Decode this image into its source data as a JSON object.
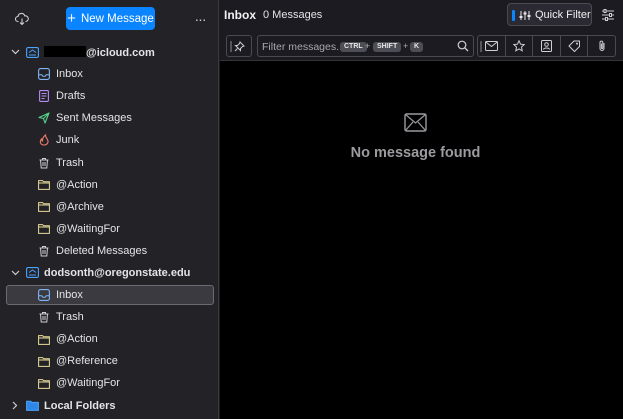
{
  "toolbar": {
    "get_messages_icon": "cloud-download-icon",
    "new_message_label": "New Message",
    "more_label": "···"
  },
  "accounts": [
    {
      "email_suffix": "@icloud.com",
      "redacted": true,
      "expanded": true,
      "folders": [
        {
          "label": "Inbox",
          "icon": "inbox-icon",
          "color": "#7fb5f5"
        },
        {
          "label": "Drafts",
          "icon": "drafts-icon",
          "color": "#b58cf0"
        },
        {
          "label": "Sent Messages",
          "icon": "sent-icon",
          "color": "#59d28a"
        },
        {
          "label": "Junk",
          "icon": "junk-icon",
          "color": "#f07a6a"
        },
        {
          "label": "Trash",
          "icon": "trash-icon",
          "color": "#cfcfd2"
        },
        {
          "label": "@Action",
          "icon": "folder-icon",
          "color": "#e9dd9a"
        },
        {
          "label": "@Archive",
          "icon": "folder-icon",
          "color": "#e9dd9a"
        },
        {
          "label": "@WaitingFor",
          "icon": "folder-icon",
          "color": "#e9dd9a"
        },
        {
          "label": "Deleted Messages",
          "icon": "trash-icon",
          "color": "#cfcfd2"
        }
      ]
    },
    {
      "email": "dodsonth@oregonstate.edu",
      "expanded": true,
      "folders": [
        {
          "label": "Inbox",
          "icon": "inbox-icon",
          "color": "#7fb5f5",
          "selected": true
        },
        {
          "label": "Trash",
          "icon": "trash-icon",
          "color": "#cfcfd2"
        },
        {
          "label": "@Action",
          "icon": "folder-icon",
          "color": "#e9dd9a"
        },
        {
          "label": "@Reference",
          "icon": "folder-icon",
          "color": "#e9dd9a"
        },
        {
          "label": "@WaitingFor",
          "icon": "folder-icon",
          "color": "#e9dd9a"
        }
      ]
    }
  ],
  "local_folders": {
    "label": "Local Folders",
    "expanded": false
  },
  "header": {
    "folder_title": "Inbox",
    "message_count": "0 Messages",
    "quick_filter_label": "Quick Filter"
  },
  "filter": {
    "placeholder": "Filter messages...",
    "shortcut": [
      "CTRL",
      "SHIFT",
      "K"
    ],
    "toggle_icons": [
      "unread-icon",
      "star-icon",
      "contact-icon",
      "tag-icon",
      "attachment-icon"
    ]
  },
  "empty_state": {
    "text": "No message found"
  },
  "colors": {
    "accent": "#0a84ff",
    "pane_bg": "#232327",
    "list_bg": "#000000"
  }
}
